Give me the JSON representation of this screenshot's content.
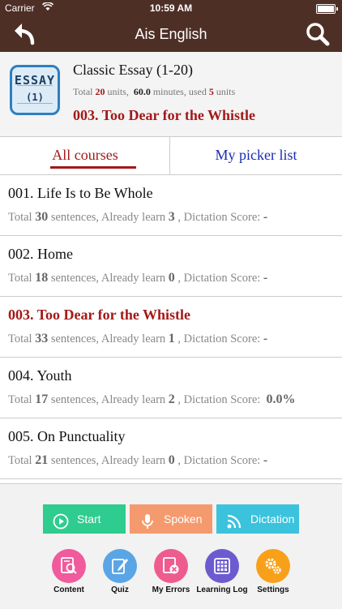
{
  "status_bar": {
    "carrier": "Carrier",
    "time": "10:59 AM"
  },
  "nav": {
    "title": "Ais English",
    "left_icon": "back-arrow-icon",
    "right_icon": "search-icon"
  },
  "book": {
    "icon_text_top": "ESSAY",
    "icon_text_bottom": "(1)",
    "title": "Classic Essay (1-20)",
    "meta_total_prefix": "Total",
    "units_total": "20",
    "meta_units_label": "units,",
    "minutes": "60.0",
    "meta_minutes_label": "minutes, used",
    "units_used": "5",
    "meta_used_suffix": "units",
    "current_lesson": "003. Too Dear for the Whistle"
  },
  "tabs": {
    "all": "All courses",
    "picker": "My picker list"
  },
  "labels": {
    "total": "Total",
    "sentences_learned": "sentences, Already learn",
    "dictation": ", Dictation Score:"
  },
  "lessons": [
    {
      "name": "001. Life Is to Be Whole",
      "total": "30",
      "learned": "3",
      "score": "-",
      "active": false
    },
    {
      "name": "002. Home",
      "total": "18",
      "learned": "0",
      "score": "-",
      "active": false
    },
    {
      "name": "003. Too Dear for the Whistle",
      "total": "33",
      "learned": "1",
      "score": "-",
      "active": true
    },
    {
      "name": "004. Youth",
      "total": "17",
      "learned": "2",
      "score": "0.0%",
      "active": false
    },
    {
      "name": "005. On Punctuality",
      "total": "21",
      "learned": "0",
      "score": "-",
      "active": false
    }
  ],
  "actions": {
    "start": "Start",
    "spoken": "Spoken",
    "dictation": "Dictation"
  },
  "tools": {
    "content": "Content",
    "quiz": "Quiz",
    "errors": "My Errors",
    "log": "Learning Log",
    "settings": "Settings"
  },
  "colors": {
    "nav_bg": "#4e2f26",
    "accent_red": "#a31919",
    "link_blue": "#1a2bb0",
    "start_green": "#2ecc8f",
    "spoken_orange": "#f59a6e",
    "dictation_cyan": "#3bc2dc",
    "content_pink": "#ef5b9c",
    "quiz_blue": "#5aa5e6",
    "errors_pink": "#ee5c8f",
    "log_purple": "#6b5bcf",
    "settings_orange": "#f9a01b"
  }
}
